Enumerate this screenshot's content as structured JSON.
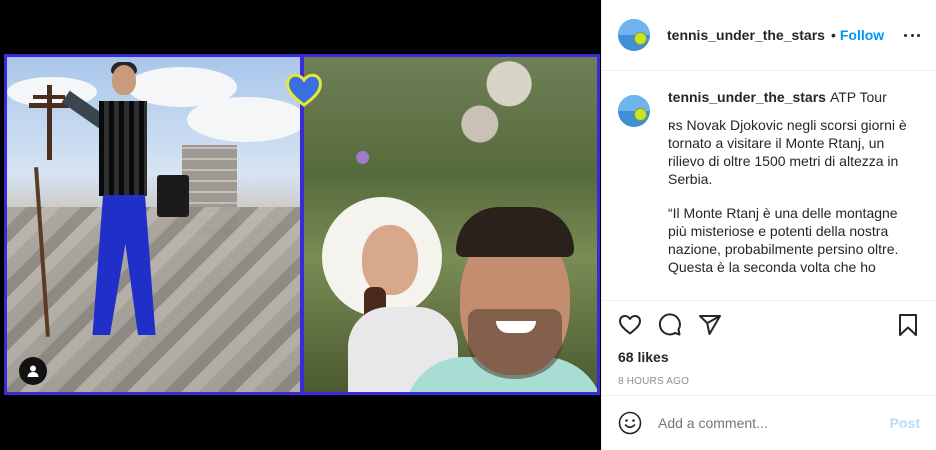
{
  "post": {
    "username": "tennis_under_the_stars",
    "follow_label": "Follow",
    "location": "ATP Tour",
    "caption_paragraphs": [
      "ʀs Novak Djokovic negli scorsi giorni è tornato a visitare il Monte Rtanj, un rilievo di oltre 1500 metri di altezza in Serbia.",
      "“Il Monte Rtanj è una delle montagne più misteriose e potenti della nostra nazione, probabilmente persino oltre. Questa è la seconda volta che ho"
    ],
    "likes": "68 likes",
    "timestamp": "8 hours ago",
    "comment_placeholder": "Add a comment...",
    "post_label": "Post"
  },
  "colors": {
    "accent": "#0095f6",
    "post_disabled": "#b2dffc",
    "collage_border": "#3a2bd6"
  },
  "icons": {
    "more": "more-options-icon",
    "like": "heart-icon",
    "comment": "comment-icon",
    "share": "share-icon",
    "save": "bookmark-icon",
    "emoji": "emoji-icon",
    "tag": "user-tag-icon"
  }
}
